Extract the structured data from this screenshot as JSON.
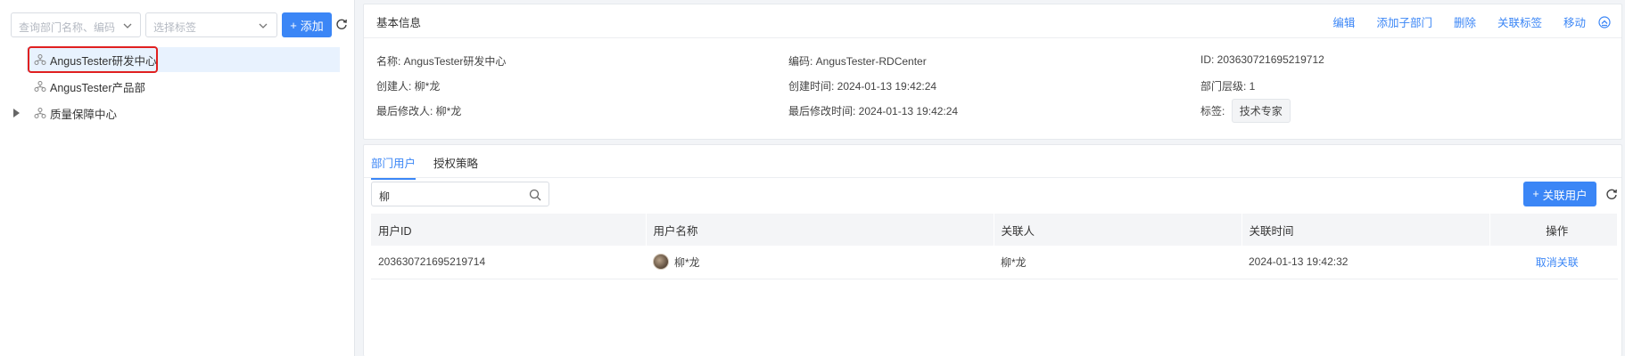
{
  "left": {
    "search_placeholder": "查询部门名称、编码",
    "tag_placeholder": "选择标签",
    "add_label": "添加",
    "tree": [
      {
        "label": "AngusTester研发中心",
        "selected": true
      },
      {
        "label": "AngusTester产品部",
        "selected": false
      },
      {
        "label": "质量保障中心",
        "selected": false,
        "expandable": true
      }
    ]
  },
  "info": {
    "title": "基本信息",
    "actions": [
      "编辑",
      "添加子部门",
      "删除",
      "关联标签",
      "移动"
    ],
    "name": "名称: AngusTester研发中心",
    "code": "编码: AngusTester-RDCenter",
    "id": "ID: 203630721695219712",
    "creator": "创建人: 柳*龙",
    "created_time": "创建时间: 2024-01-13 19:42:24",
    "level": "部门层级: 1",
    "modifier": "最后修改人: 柳*龙",
    "modified_time": "最后修改时间: 2024-01-13 19:42:24",
    "tag_label": "标签:",
    "tag_value": "技术专家"
  },
  "users": {
    "tabs": [
      "部门用户",
      "授权策略"
    ],
    "search_value": "柳",
    "link_button": "关联用户",
    "columns": [
      "用户ID",
      "用户名称",
      "关联人",
      "关联时间",
      "操作"
    ],
    "rows": [
      {
        "id": "203630721695219714",
        "name": "柳*龙",
        "linker": "柳*龙",
        "time": "2024-01-13 19:42:32",
        "action": "取消关联"
      }
    ]
  },
  "colors": {
    "accent": "#3b86f6",
    "highlight_frame": "#e02020"
  }
}
